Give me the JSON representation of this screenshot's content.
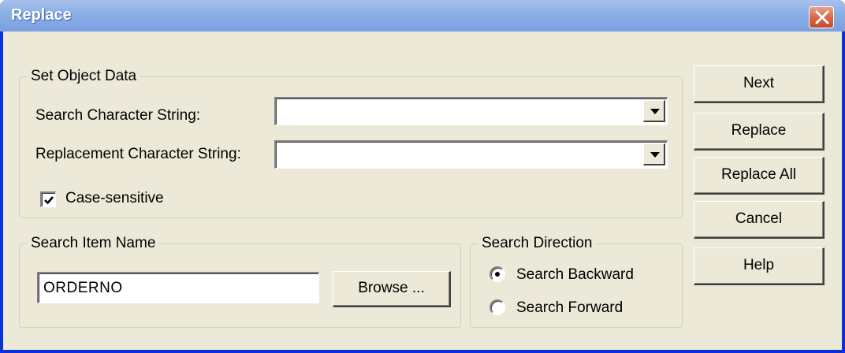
{
  "window": {
    "title": "Replace"
  },
  "set_object_data": {
    "legend": "Set Object Data",
    "search_label": "Search Character String:",
    "search_value": "",
    "replacement_label": "Replacement Character String:",
    "replacement_value": "",
    "case_sensitive_label": "Case-sensitive",
    "case_sensitive_checked": true
  },
  "search_item": {
    "legend": "Search Item Name",
    "value": "ORDERNO",
    "browse_label": "Browse ..."
  },
  "search_direction": {
    "legend": "Search Direction",
    "options": [
      {
        "label": "Search Backward",
        "selected": true
      },
      {
        "label": "Search Forward",
        "selected": false
      }
    ]
  },
  "buttons": {
    "next": "Next",
    "replace": "Replace",
    "replace_all": "Replace All",
    "cancel": "Cancel",
    "help": "Help"
  },
  "icons": {
    "close": "close-icon",
    "dropdown": "chevron-down-icon",
    "check": "checkmark-icon"
  },
  "colors": {
    "titlebar": "#8aaee6",
    "close_button": "#d8694a",
    "dialog_background": "#ece9d8"
  }
}
